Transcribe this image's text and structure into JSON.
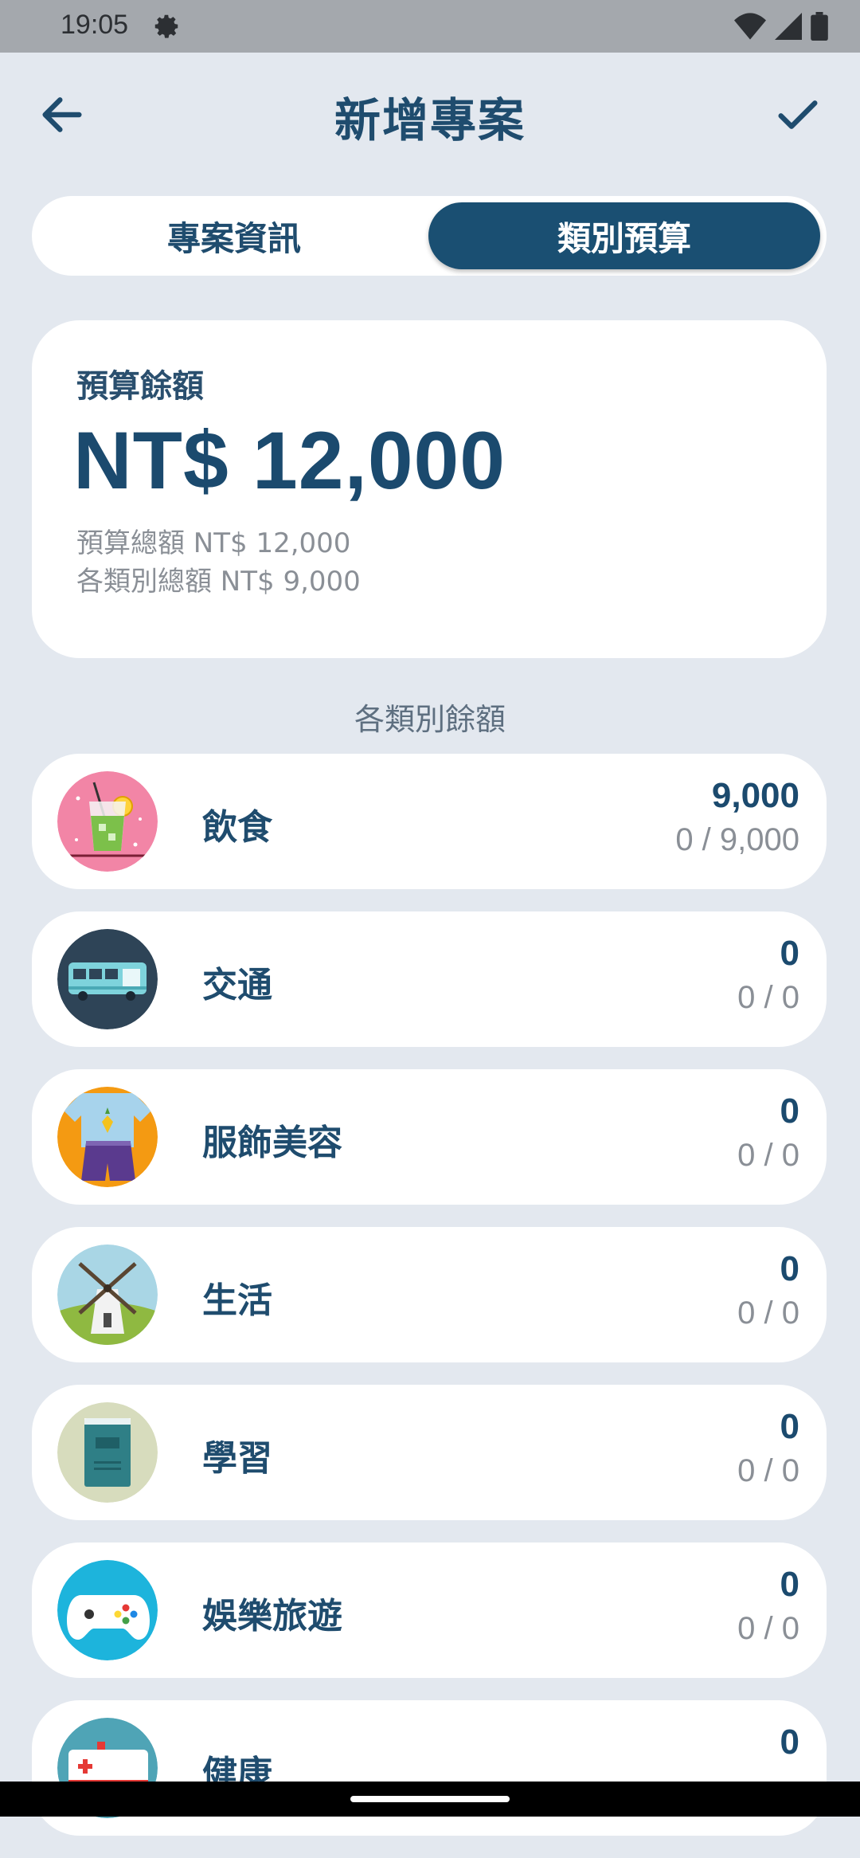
{
  "status_bar": {
    "time": "19:05"
  },
  "header": {
    "title": "新增專案"
  },
  "tabs": [
    {
      "label": "專案資訊",
      "active": false
    },
    {
      "label": "類別預算",
      "active": true
    }
  ],
  "summary": {
    "label": "預算餘額",
    "amount": "NT$ 12,000",
    "total_budget": "預算總額 NT$ 12,000",
    "category_total": "各類別總額 NT$ 9,000"
  },
  "section_label": "各類別餘額",
  "categories": [
    {
      "name": "飲食",
      "amount": "9,000",
      "ratio": "0 / 9,000",
      "icon": "drink-icon"
    },
    {
      "name": "交通",
      "amount": "0",
      "ratio": "0 / 0",
      "icon": "bus-icon"
    },
    {
      "name": "服飾美容",
      "amount": "0",
      "ratio": "0 / 0",
      "icon": "clothing-icon"
    },
    {
      "name": "生活",
      "amount": "0",
      "ratio": "0 / 0",
      "icon": "windmill-icon"
    },
    {
      "name": "學習",
      "amount": "0",
      "ratio": "0 / 0",
      "icon": "book-icon"
    },
    {
      "name": "娛樂旅遊",
      "amount": "0",
      "ratio": "0 / 0",
      "icon": "gamepad-icon"
    },
    {
      "name": "健康",
      "amount": "0",
      "ratio": "",
      "icon": "ambulance-icon"
    }
  ],
  "colors": {
    "primary": "#1a4f72",
    "background": "#e3e8ef",
    "card": "#ffffff",
    "muted_text": "#8a8f96"
  }
}
